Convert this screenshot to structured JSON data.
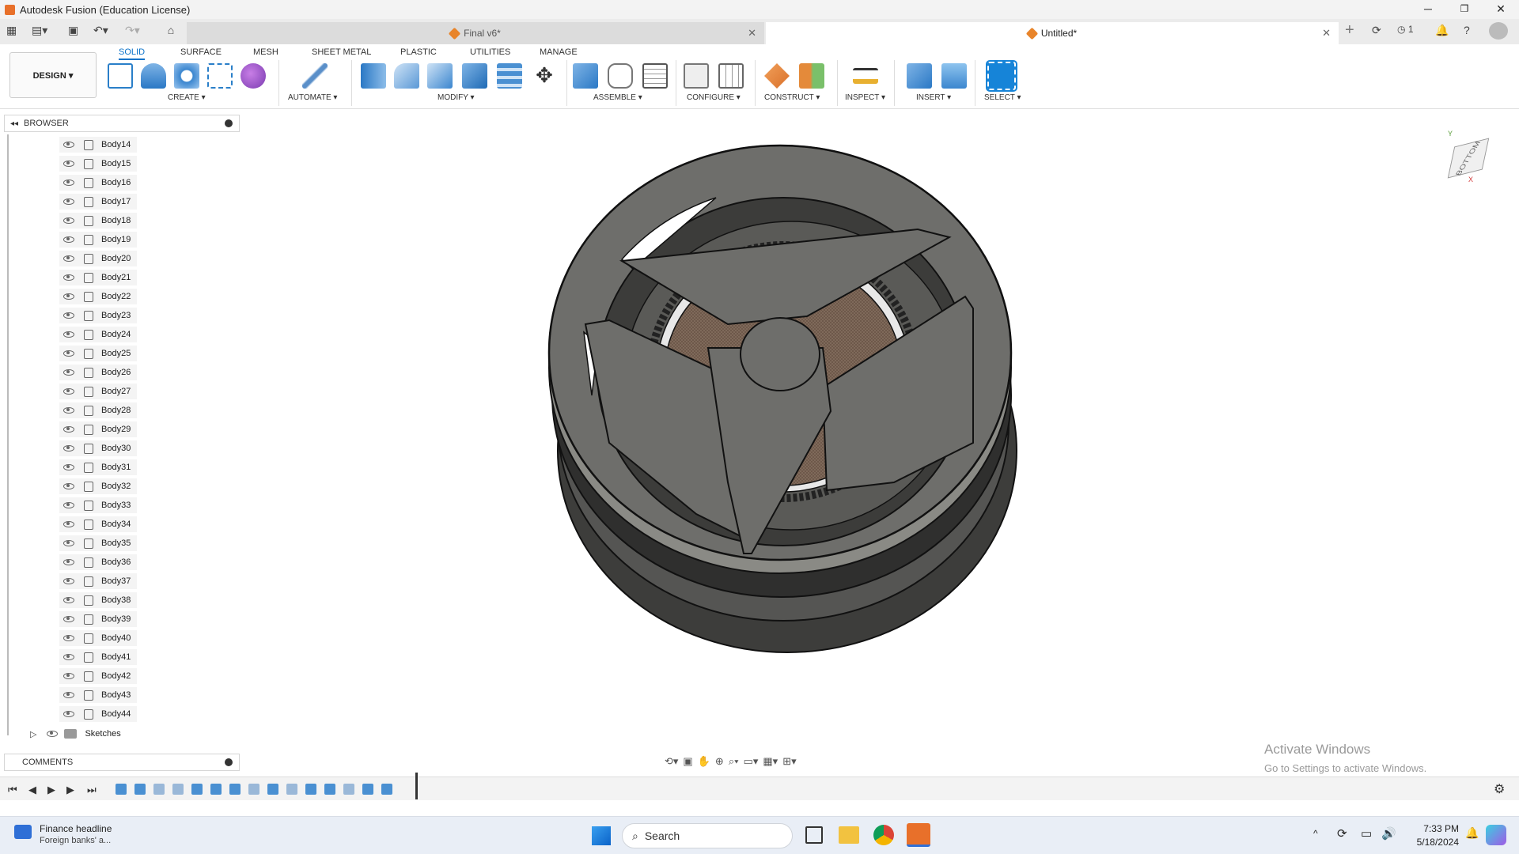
{
  "window": {
    "title": "Autodesk Fusion (Education License)",
    "minimize": "─",
    "maximize": "❐",
    "close": "✕"
  },
  "tabs": [
    {
      "label": "Final v6*",
      "close": "✕"
    },
    {
      "label": "Untitled*",
      "close": "✕"
    }
  ],
  "tabbar": {
    "new_tab": "+",
    "online_count": "1"
  },
  "ribbon": {
    "workspace": "DESIGN ▾",
    "tabs": [
      "SOLID",
      "SURFACE",
      "MESH",
      "SHEET METAL",
      "PLASTIC",
      "UTILITIES",
      "MANAGE"
    ],
    "active_tab": "SOLID",
    "groups": [
      "CREATE ▾",
      "AUTOMATE ▾",
      "MODIFY ▾",
      "ASSEMBLE ▾",
      "CONFIGURE ▾",
      "CONSTRUCT ▾",
      "INSPECT ▾",
      "INSERT ▾",
      "SELECT ▾"
    ]
  },
  "browser": {
    "title": "BROWSER",
    "bodies": [
      "Body14",
      "Body15",
      "Body16",
      "Body17",
      "Body18",
      "Body19",
      "Body20",
      "Body21",
      "Body22",
      "Body23",
      "Body24",
      "Body25",
      "Body26",
      "Body27",
      "Body28",
      "Body29",
      "Body30",
      "Body31",
      "Body32",
      "Body33",
      "Body34",
      "Body35",
      "Body36",
      "Body37",
      "Body38",
      "Body39",
      "Body40",
      "Body41",
      "Body42",
      "Body43",
      "Body44"
    ],
    "sketches": "Sketches"
  },
  "comments": {
    "title": "COMMENTS"
  },
  "viewcube": {
    "face": "BOTTOM"
  },
  "watermark": {
    "line1": "Activate Windows",
    "line2": "Go to Settings to activate Windows."
  },
  "taskbar": {
    "news_title": "Finance headline",
    "news_sub": "Foreign banks' a...",
    "search_placeholder": "Search",
    "time": "7:33 PM",
    "date": "5/18/2024"
  },
  "colors": {
    "accent": "#0a72c9",
    "model_fill": "#6e6e6b",
    "model_dark": "#3c3c3a",
    "mesh": "#6b5648"
  }
}
